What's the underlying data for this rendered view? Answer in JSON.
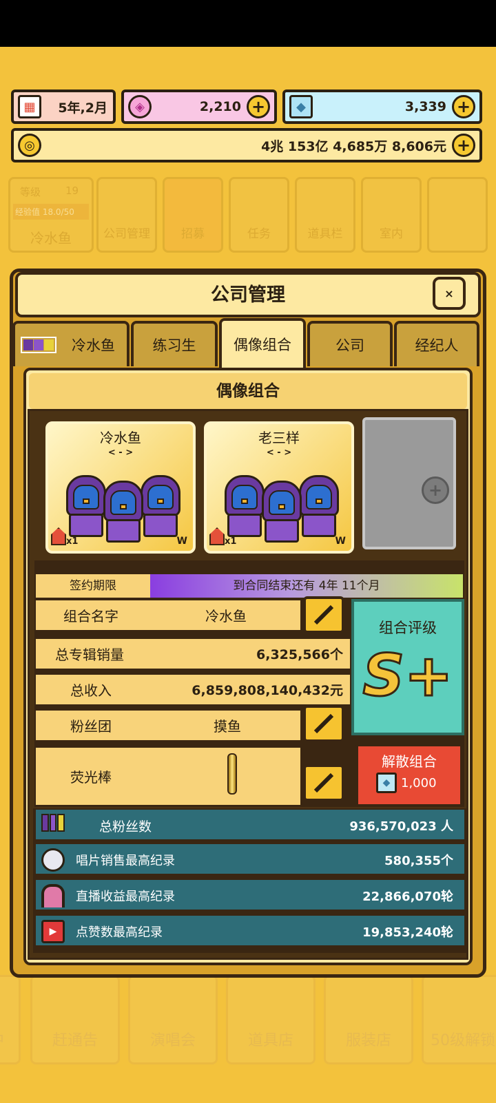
{
  "top_bar": {
    "date": "5年,2月",
    "pink_currency": "2,210",
    "diamond_currency": "3,339",
    "money": "4兆 153亿 4,685万 8,606元"
  },
  "bg_menu": {
    "level_label": "等级",
    "level_value": "19",
    "exp_label": "经验值 18.0/50",
    "group_name": "冷水鱼",
    "items": [
      "公司管理",
      "招募",
      "任务",
      "道具栏",
      "室内"
    ],
    "bottom": [
      "中",
      "赶通告",
      "演唱会",
      "道具店",
      "服装店",
      "50级解锁"
    ]
  },
  "modal": {
    "title": "公司管理",
    "close": "×",
    "tabs": [
      "冷水鱼",
      "练习生",
      "偶像组合",
      "公司",
      "经纪人"
    ],
    "active_tab": 2,
    "section_title": "偶像组合"
  },
  "groups": [
    {
      "name": "冷水鱼",
      "arrows": "< - >",
      "count": "x1",
      "badge": "W"
    },
    {
      "name": "老三样",
      "arrows": "< - >",
      "count": "x1",
      "badge": "W"
    }
  ],
  "empty_slot_plus": "+",
  "contract": {
    "label": "签约期限",
    "text": "到合同结束还有 4年 11个月"
  },
  "details": {
    "group_name_label": "组合名字",
    "group_name_value": "冷水鱼",
    "album_sales_label": "总专辑销量",
    "album_sales_value": "6,325,566个",
    "revenue_label": "总收入",
    "revenue_value": "6,859,808,140,432元",
    "fanclub_label": "粉丝团",
    "fanclub_value": "摸鱼",
    "lightstick_label": "荧光棒"
  },
  "rating": {
    "label": "组合评级",
    "grade": "S+"
  },
  "disband": {
    "label": "解散组合",
    "cost": "1,000"
  },
  "stats": [
    {
      "label": "总粉丝数",
      "value": "936,570,023 人",
      "icon": "fans-icon"
    },
    {
      "label": "唱片销售最高纪录",
      "value": "580,355个",
      "icon": "disc-icon"
    },
    {
      "label": "直播收益最高纪录",
      "value": "22,866,070轮",
      "icon": "headphones-icon"
    },
    {
      "label": "点赞数最高纪录",
      "value": "19,853,240轮",
      "icon": "video-icon"
    }
  ],
  "colors": {
    "accent_yellow": "#f6c830",
    "rating_teal": "#5dcfbd",
    "disband_red": "#e84a34",
    "stats_teal": "#2e6d78",
    "contract_gradient": [
      "#8a3ee0",
      "#c8e36a"
    ]
  }
}
